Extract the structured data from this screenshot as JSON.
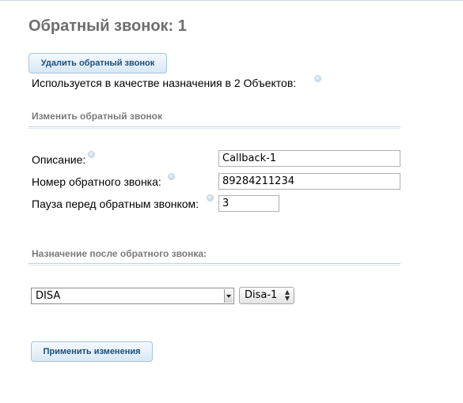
{
  "page": {
    "title": "Обратный звонок: 1"
  },
  "actions": {
    "delete_label": "Удалить обратный звонок",
    "apply_label": "Применить изменения"
  },
  "usage": {
    "text": "Используется в качестве назначения в 2 Объектов:"
  },
  "edit_section": {
    "title": "Изменить обратный звонок",
    "fields": {
      "description": {
        "label": "Описание:",
        "value": "Callback-1"
      },
      "number": {
        "label": "Номер обратного звонка:",
        "value": "89284211234"
      },
      "pause": {
        "label": "Пауза перед обратным звонком:",
        "value": "3"
      }
    }
  },
  "destination_section": {
    "title": "Назначение после обратного звонка:",
    "type_value": "DISA",
    "target_value": "Disa-1"
  }
}
